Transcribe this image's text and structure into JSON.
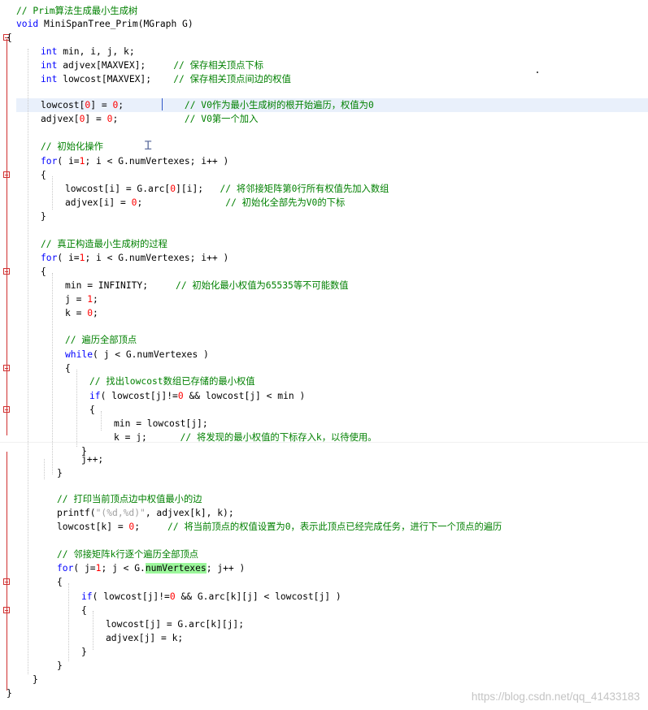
{
  "editor": {
    "language": "C",
    "current_line_index": 6,
    "lines": [
      {
        "segments": [
          {
            "c": "cm",
            "t": "// Prim算法生成最小生成树"
          }
        ]
      },
      {
        "segments": [
          {
            "c": "kw",
            "t": "void"
          },
          {
            "c": "plain",
            "t": " MiniSpanTree_Prim(MGraph G)"
          }
        ]
      },
      {
        "segments": [
          {
            "c": "plain",
            "t": "{"
          }
        ]
      },
      {
        "segments": [
          {
            "c": "kw",
            "t": "int"
          },
          {
            "c": "plain",
            "t": " min, i, j, k;"
          }
        ]
      },
      {
        "segments": [
          {
            "c": "kw",
            "t": "int"
          },
          {
            "c": "plain",
            "t": " adjvex[MAXVEX];     "
          },
          {
            "c": "cm",
            "t": "// 保存相关顶点下标"
          }
        ]
      },
      {
        "segments": [
          {
            "c": "kw",
            "t": "int"
          },
          {
            "c": "plain",
            "t": " lowcost[MAXVEX];    "
          },
          {
            "c": "cm",
            "t": "// 保存相关顶点间边的权值"
          }
        ]
      },
      {
        "segments": [
          {
            "c": "plain",
            "t": "lowcost["
          },
          {
            "c": "num",
            "t": "0"
          },
          {
            "c": "plain",
            "t": "] = "
          },
          {
            "c": "num",
            "t": "0"
          },
          {
            "c": "plain",
            "t": ";           "
          },
          {
            "c": "cm",
            "t": "// V0作为最小生成树的根开始遍历，权值为0"
          }
        ]
      },
      {
        "segments": [
          {
            "c": "plain",
            "t": "adjvex["
          },
          {
            "c": "num",
            "t": "0"
          },
          {
            "c": "plain",
            "t": "] = "
          },
          {
            "c": "num",
            "t": "0"
          },
          {
            "c": "plain",
            "t": ";            "
          },
          {
            "c": "cm",
            "t": "// V0第一个加入"
          }
        ]
      },
      {
        "segments": [
          {
            "c": "cm",
            "t": "// 初始化操作"
          }
        ]
      },
      {
        "segments": [
          {
            "c": "kw",
            "t": "for"
          },
          {
            "c": "plain",
            "t": "( i="
          },
          {
            "c": "num",
            "t": "1"
          },
          {
            "c": "plain",
            "t": "; i < G.numVertexes; i++ )"
          }
        ]
      },
      {
        "segments": [
          {
            "c": "plain",
            "t": "{"
          }
        ]
      },
      {
        "segments": [
          {
            "c": "plain",
            "t": "lowcost[i] = G.arc["
          },
          {
            "c": "num",
            "t": "0"
          },
          {
            "c": "plain",
            "t": "][i];   "
          },
          {
            "c": "cm",
            "t": "// 将邻接矩阵第0行所有权值先加入数组"
          }
        ]
      },
      {
        "segments": [
          {
            "c": "plain",
            "t": "adjvex[i] = "
          },
          {
            "c": "num",
            "t": "0"
          },
          {
            "c": "plain",
            "t": ";               "
          },
          {
            "c": "cm",
            "t": "// 初始化全部先为V0的下标"
          }
        ]
      },
      {
        "segments": [
          {
            "c": "plain",
            "t": "}"
          }
        ]
      },
      {
        "segments": [
          {
            "c": "cm",
            "t": "// 真正构造最小生成树的过程"
          }
        ]
      },
      {
        "segments": [
          {
            "c": "kw",
            "t": "for"
          },
          {
            "c": "plain",
            "t": "( i="
          },
          {
            "c": "num",
            "t": "1"
          },
          {
            "c": "plain",
            "t": "; i < G.numVertexes; i++ )"
          }
        ]
      },
      {
        "segments": [
          {
            "c": "plain",
            "t": "{"
          }
        ]
      },
      {
        "segments": [
          {
            "c": "plain",
            "t": "min = INFINITY;     "
          },
          {
            "c": "cm",
            "t": "// 初始化最小权值为65535等不可能数值"
          }
        ]
      },
      {
        "segments": [
          {
            "c": "plain",
            "t": "j = "
          },
          {
            "c": "num",
            "t": "1"
          },
          {
            "c": "plain",
            "t": ";"
          }
        ]
      },
      {
        "segments": [
          {
            "c": "plain",
            "t": "k = "
          },
          {
            "c": "num",
            "t": "0"
          },
          {
            "c": "plain",
            "t": ";"
          }
        ]
      },
      {
        "segments": [
          {
            "c": "cm",
            "t": "// 遍历全部顶点"
          }
        ]
      },
      {
        "segments": [
          {
            "c": "kw",
            "t": "while"
          },
          {
            "c": "plain",
            "t": "( j < G.numVertexes )"
          }
        ]
      },
      {
        "segments": [
          {
            "c": "plain",
            "t": "{"
          }
        ]
      },
      {
        "segments": [
          {
            "c": "cm",
            "t": "// 找出lowcost数组已存储的最小权值"
          }
        ]
      },
      {
        "segments": [
          {
            "c": "kw",
            "t": "if"
          },
          {
            "c": "plain",
            "t": "( lowcost[j]!="
          },
          {
            "c": "num",
            "t": "0"
          },
          {
            "c": "plain",
            "t": " && lowcost[j] < min )"
          }
        ]
      },
      {
        "segments": [
          {
            "c": "plain",
            "t": "{"
          }
        ]
      },
      {
        "segments": [
          {
            "c": "plain",
            "t": "min = lowcost[j];"
          }
        ]
      },
      {
        "segments": [
          {
            "c": "plain",
            "t": "k = j;      "
          },
          {
            "c": "cm",
            "t": "// 将发现的最小权值的下标存入k，以待使用。"
          }
        ]
      },
      {
        "segments": [
          {
            "c": "plain",
            "t": "}"
          }
        ]
      },
      {
        "segments": [
          {
            "c": "plain",
            "t": "j++;"
          }
        ]
      },
      {
        "segments": [
          {
            "c": "plain",
            "t": "}"
          }
        ]
      },
      {
        "segments": [
          {
            "c": "cm",
            "t": "// 打印当前顶点边中权值最小的边"
          }
        ]
      },
      {
        "segments": [
          {
            "c": "plain",
            "t": "printf("
          },
          {
            "c": "str",
            "t": "\"(%d,%d)\""
          },
          {
            "c": "plain",
            "t": ", adjvex[k], k);"
          }
        ]
      },
      {
        "segments": [
          {
            "c": "plain",
            "t": "lowcost[k] = "
          },
          {
            "c": "num",
            "t": "0"
          },
          {
            "c": "plain",
            "t": ";     "
          },
          {
            "c": "cm",
            "t": "// 将当前顶点的权值设置为0，表示此顶点已经完成任务，进行下一个顶点的遍历"
          }
        ]
      },
      {
        "segments": [
          {
            "c": "cm",
            "t": "// 邻接矩阵k行逐个遍历全部顶点"
          }
        ]
      },
      {
        "segments": [
          {
            "c": "kw",
            "t": "for"
          },
          {
            "c": "plain",
            "t": "( j="
          },
          {
            "c": "num",
            "t": "1"
          },
          {
            "c": "plain",
            "t": "; j < G."
          },
          {
            "c": "plain hl",
            "t": "numVertexes"
          },
          {
            "c": "plain",
            "t": "; j++ )"
          }
        ]
      },
      {
        "segments": [
          {
            "c": "plain",
            "t": "{"
          }
        ]
      },
      {
        "segments": [
          {
            "c": "kw",
            "t": "if"
          },
          {
            "c": "plain",
            "t": "( lowcost[j]!="
          },
          {
            "c": "num",
            "t": "0"
          },
          {
            "c": "plain",
            "t": " && G.arc[k][j] < lowcost[j] )"
          }
        ]
      },
      {
        "segments": [
          {
            "c": "plain",
            "t": "{"
          }
        ]
      },
      {
        "segments": [
          {
            "c": "plain",
            "t": "lowcost[j] = G.arc[k][j];"
          }
        ]
      },
      {
        "segments": [
          {
            "c": "plain",
            "t": "adjvex[j] = k;"
          }
        ]
      },
      {
        "segments": [
          {
            "c": "plain",
            "t": "}"
          }
        ]
      },
      {
        "segments": [
          {
            "c": "plain",
            "t": "}"
          }
        ]
      },
      {
        "segments": [
          {
            "c": "plain",
            "t": "}"
          }
        ]
      },
      {
        "segments": [
          {
            "c": "plain",
            "t": "}"
          }
        ]
      }
    ]
  },
  "watermark": "https://blog.csdn.net/qq_41433183",
  "colors": {
    "keyword": "#0000ff",
    "comment": "#008000",
    "number": "#ff0000",
    "string": "#a0a0a0",
    "text": "#000000",
    "highlight": "#9bf79b",
    "current_line": "#e9f0fb",
    "fold_marker": "#d03030"
  },
  "icons": {
    "text_cursor": "i-beam-cursor-icon",
    "fold_marker": "fold-collapse-icon"
  }
}
